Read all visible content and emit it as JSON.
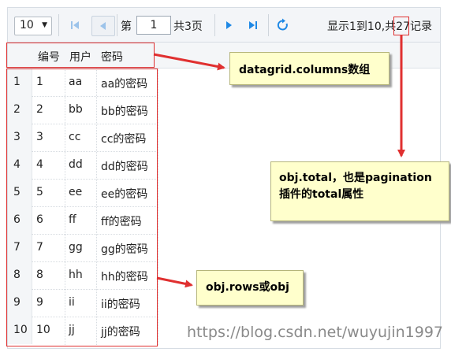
{
  "pagination": {
    "page_size": "10",
    "page_prefix": "第",
    "current_page": "1",
    "total_pages_label": "共3页",
    "info": "显示1到10,共27记录"
  },
  "grid": {
    "columns": [
      "编号",
      "用户",
      "密码"
    ],
    "rows": [
      {
        "rownum": "1",
        "id": "1",
        "user": "aa",
        "pwd": "aa的密码"
      },
      {
        "rownum": "2",
        "id": "2",
        "user": "bb",
        "pwd": "bb的密码"
      },
      {
        "rownum": "3",
        "id": "3",
        "user": "cc",
        "pwd": "cc的密码"
      },
      {
        "rownum": "4",
        "id": "4",
        "user": "dd",
        "pwd": "dd的密码"
      },
      {
        "rownum": "5",
        "id": "5",
        "user": "ee",
        "pwd": "ee的密码"
      },
      {
        "rownum": "6",
        "id": "6",
        "user": "ff",
        "pwd": "ff的密码"
      },
      {
        "rownum": "7",
        "id": "7",
        "user": "gg",
        "pwd": "gg的密码"
      },
      {
        "rownum": "8",
        "id": "8",
        "user": "hh",
        "pwd": "hh的密码"
      },
      {
        "rownum": "9",
        "id": "9",
        "user": "ii",
        "pwd": "ii的密码"
      },
      {
        "rownum": "10",
        "id": "10",
        "user": "jj",
        "pwd": "jj的密码"
      }
    ]
  },
  "annotations": {
    "columns_note": "datagrid.columns数组",
    "total_note_line1": "obj.total，也是pagination",
    "total_note_line2": "插件的total属性",
    "rows_note": "obj.rows或obj"
  },
  "watermark": "https://blog.csdn.net/wuyujin1997",
  "colors": {
    "annotation_red": "#e03030",
    "note_bg": "#ffffcc",
    "nav_blue": "#1e88e5"
  }
}
